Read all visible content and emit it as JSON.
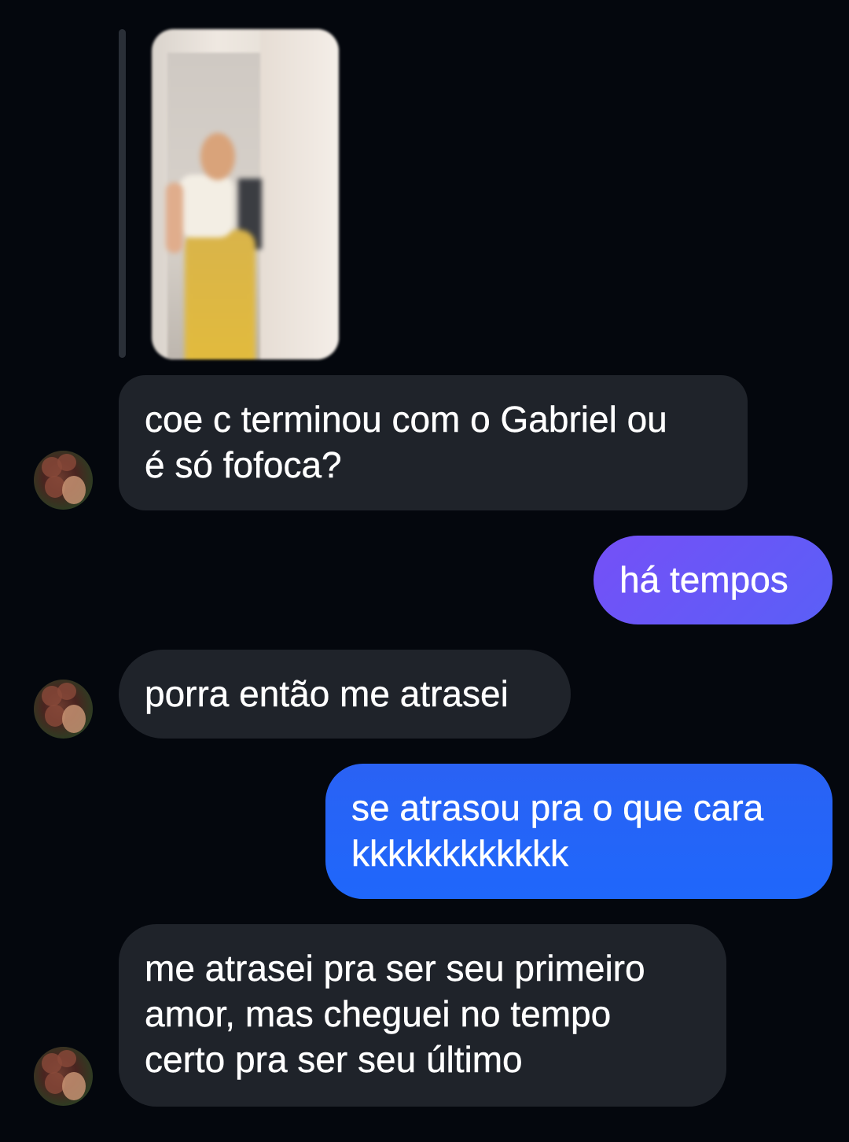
{
  "conversation": {
    "reply_preview": {
      "image_alt": "blurred photo of a person in a white top and yellow skirt"
    },
    "messages": [
      {
        "direction": "incoming",
        "lines": [
          "coe c terminou com o Gabriel ou",
          "é só fofoca?"
        ]
      },
      {
        "direction": "outgoing",
        "lines": [
          "há tempos"
        ]
      },
      {
        "direction": "incoming",
        "lines": [
          "porra então me atrasei"
        ]
      },
      {
        "direction": "outgoing",
        "lines": [
          "se atrasou pra o que cara",
          "kkkkkkkkkkkk"
        ]
      },
      {
        "direction": "incoming",
        "lines": [
          "me atrasei pra ser seu primeiro",
          "amor, mas cheguei no tempo",
          "certo pra ser seu último"
        ]
      }
    ]
  },
  "colors": {
    "background": "#04070d",
    "incoming_bubble": "#1f232a",
    "outgoing_bubble_purple": "#6b55f7",
    "outgoing_bubble_blue": "#2464f7",
    "reply_bar": "#2a2f37"
  }
}
